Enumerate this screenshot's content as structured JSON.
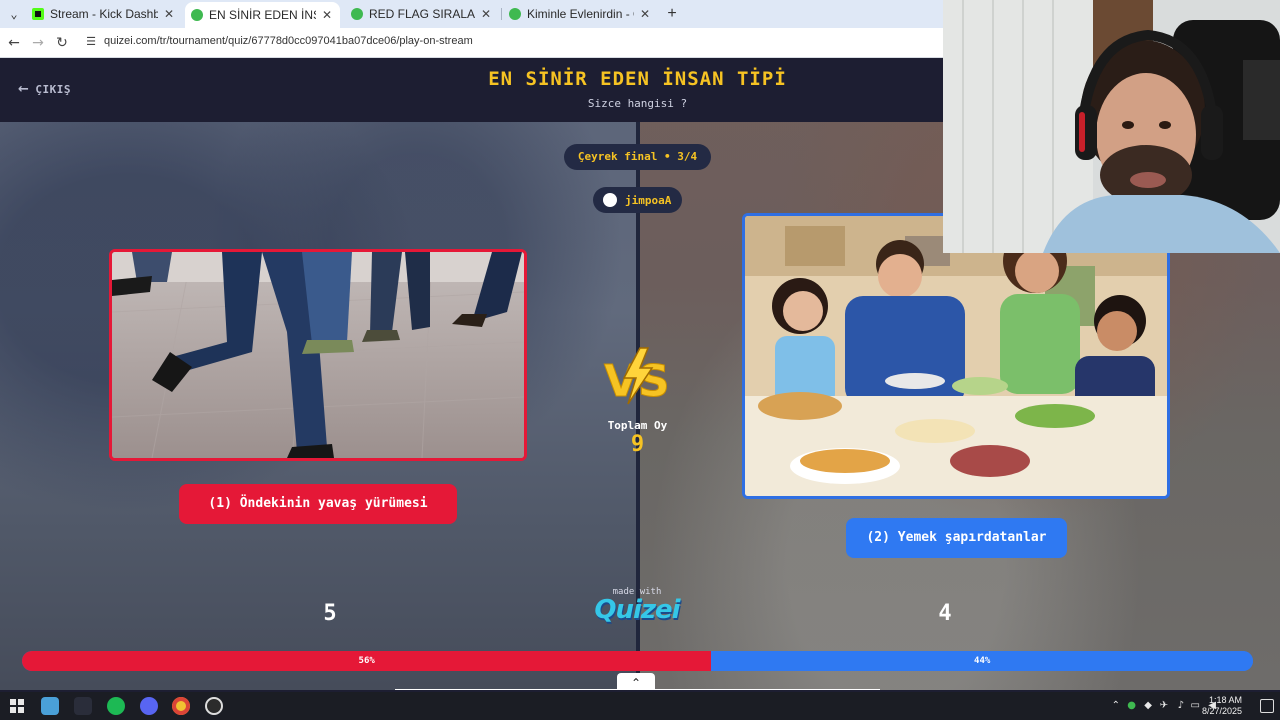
{
  "browser": {
    "tabs": [
      {
        "title": "Stream - Kick Dashboard",
        "active": false,
        "favicon_color": "#53fc18"
      },
      {
        "title": "EN SİNİR EDEN İNSAN TİPİ - Qu",
        "active": true,
        "favicon_color": "#3fb950"
      },
      {
        "title": "RED FLAG SIRALAMASI - Quizei",
        "active": false,
        "favicon_color": "#3fb950"
      },
      {
        "title": "Kiminle Evlenirdin - Quizei",
        "active": false,
        "favicon_color": "#3fb950"
      }
    ],
    "url": "quizei.com/tr/tournament/quiz/67778d0cc097041ba07dce06/play-on-stream"
  },
  "header": {
    "exit_label": "ÇIKIŞ",
    "title": "EN SİNİR EDEN İNSAN TİPİ",
    "subtitle": "Sizce hangisi ?"
  },
  "round": {
    "label": "Çeyrek final • 3/4"
  },
  "user": {
    "name": "jimpoaA"
  },
  "options": {
    "left": {
      "label": "(1) Öndekinin yavaş yürümesi",
      "votes": "5",
      "percent_label": "56%",
      "percent": 56,
      "color": "#e51837"
    },
    "right": {
      "label": "(2) Yemek şapırdatanlar",
      "votes": "4",
      "percent_label": "44%",
      "percent": 44,
      "color": "#2f79f2"
    }
  },
  "totals": {
    "label": "Toplam Oy",
    "value": "9"
  },
  "branding": {
    "made_with": "made with",
    "name": "Quizei"
  },
  "taskbar": {
    "time": "1:18 AM",
    "date": "8/27/2025"
  },
  "icons": {
    "back": "arrow-left-icon",
    "vs": "vs-lightning-icon",
    "collapse": "chevron-up-icon"
  }
}
